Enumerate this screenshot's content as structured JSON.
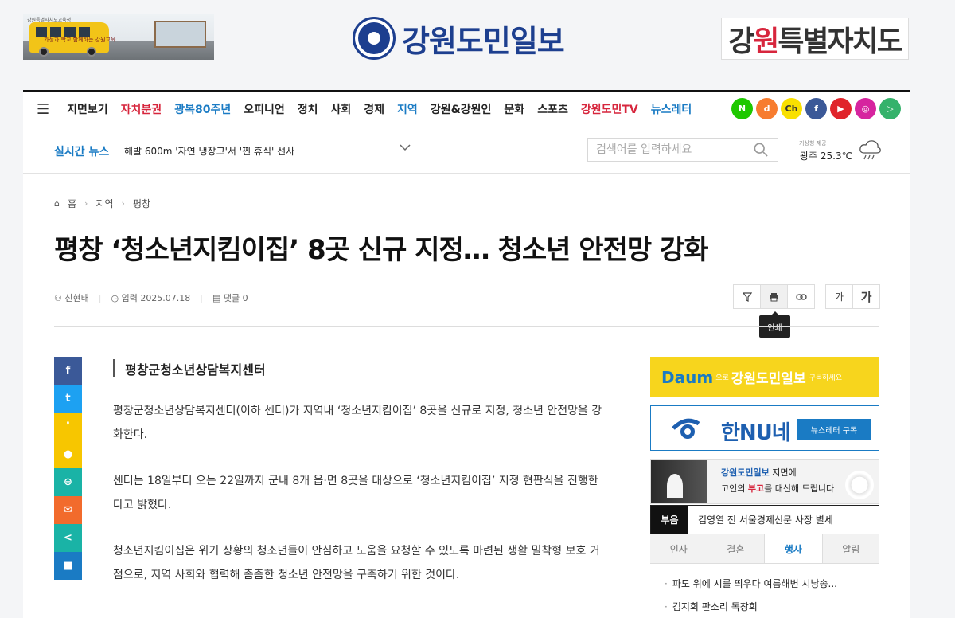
{
  "top_ad": {
    "bus_text": "가정과 학교 함께하는 강원교육",
    "tiny_text": "강원특별자치도교육청"
  },
  "brand": {
    "logo_text": "강원도민일보",
    "region_logo_prefix": "강",
    "region_logo_red": "원",
    "region_logo_rest": "특별자치도"
  },
  "nav": {
    "items": [
      {
        "label": "지면보기",
        "style": "normal"
      },
      {
        "label": "자치분권",
        "style": "red"
      },
      {
        "label": "광복80주년",
        "style": "blue"
      },
      {
        "label": "오피니언",
        "style": "normal"
      },
      {
        "label": "정치",
        "style": "normal"
      },
      {
        "label": "사회",
        "style": "normal"
      },
      {
        "label": "경제",
        "style": "normal"
      },
      {
        "label": "지역",
        "style": "blue"
      },
      {
        "label": "강원&강원인",
        "style": "normal"
      },
      {
        "label": "문화",
        "style": "normal"
      },
      {
        "label": "스포츠",
        "style": "normal"
      },
      {
        "label": "강원도민TV",
        "style": "red"
      },
      {
        "label": "뉴스레터",
        "style": "blue"
      }
    ],
    "socials": [
      {
        "name": "naver-icon",
        "glyph": "N",
        "color": "#1ec800"
      },
      {
        "name": "daum-icon",
        "glyph": "d",
        "color": "#f77c2f"
      },
      {
        "name": "kakao-channel-icon",
        "glyph": "Ch",
        "color": "#f9e000"
      },
      {
        "name": "facebook-icon",
        "glyph": "f",
        "color": "#3b5998"
      },
      {
        "name": "youtube-icon",
        "glyph": "▶",
        "color": "#e0242b"
      },
      {
        "name": "instagram-icon",
        "glyph": "◎",
        "color": "#d6249f"
      },
      {
        "name": "play-icon",
        "glyph": "▷",
        "color": "#35b26b"
      }
    ]
  },
  "ticker": {
    "label": "실시간 뉴스",
    "headline": "해발 600m '자연 냉장고'서 '찐 휴식' 선사"
  },
  "search": {
    "placeholder": "검색어를 입력하세요"
  },
  "weather": {
    "source": "기상청 제공",
    "location_temp": "광주 25.3℃"
  },
  "breadcrumb": {
    "home": "홈",
    "level1": "지역",
    "level2": "평창"
  },
  "article": {
    "headline": "평창 ‘청소년지킴이집’ 8곳 신규 지정… 청소년 안전망 강화",
    "author": "신현태",
    "date": "입력 2025.07.18",
    "comments": "댓글 0",
    "subheading": "평창군청소년상담복지센터",
    "paragraphs": [
      "평창군청소년상담복지센터(이하 센터)가 지역내 ‘청소년지킴이집’ 8곳을 신규로 지정, 청소년 안전망을 강화한다.",
      "센터는 18일부터 오는 22일까지 군내 8개 읍·면 8곳을 대상으로 ‘청소년지킴이집’ 지정 현판식을 진행한다고 밝혔다.",
      "청소년지킴이집은 위기 상황의 청소년들이 안심하고 도움을 요청할 수 있도록 마련된 생활 밀착형 보호 거점으로, 지역 사회와 협력해 촘촘한 청소년 안전망을 구축하기 위한 것이다."
    ]
  },
  "tools": {
    "font_small": "가",
    "font_large": "가",
    "tooltip": "인쇄"
  },
  "share": [
    "f",
    "t",
    "❜",
    "●",
    "⊖",
    "✉",
    "<",
    "■"
  ],
  "ads": {
    "daum": {
      "brand": "Daum",
      "connector": "으로",
      "paper": "강원도민일보",
      "cta": "구독하세요"
    },
    "hannune": {
      "name": "한NU네",
      "button": "뉴스레터 구독"
    },
    "obit": {
      "line1_brand": "강원도민일보",
      "line1_rest": " 지면에",
      "line2_a": "고인의 ",
      "line2_red": "부고",
      "line2_b": "를 대신해 드립니다"
    }
  },
  "buhoo": {
    "label": "부음",
    "text": "김영열 전 서울경제신문 사장 별세"
  },
  "tabs": [
    {
      "label": "인사",
      "active": false
    },
    {
      "label": "결혼",
      "active": false
    },
    {
      "label": "행사",
      "active": true
    },
    {
      "label": "알림",
      "active": false
    }
  ],
  "events": [
    "파도 위에 시를 띄우다 여름해변 시낭송...",
    "김지회 판소리 독창회"
  ]
}
